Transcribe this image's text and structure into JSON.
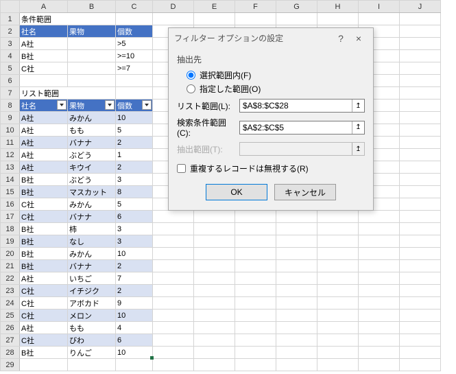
{
  "columns": [
    "A",
    "B",
    "C",
    "D",
    "E",
    "F",
    "G",
    "H",
    "I",
    "J"
  ],
  "section1": {
    "title": "条件範囲",
    "headers": [
      "社名",
      "果物",
      "個数"
    ],
    "rows": [
      {
        "c0": "A社",
        "c1": "",
        "c2": ">5"
      },
      {
        "c0": "B社",
        "c1": "",
        "c2": ">=10"
      },
      {
        "c0": "C社",
        "c1": "",
        "c2": ">=7"
      }
    ]
  },
  "section2": {
    "title": "リスト範囲",
    "headers": [
      "社名",
      "果物",
      "個数"
    ],
    "rows": [
      {
        "c0": "A社",
        "c1": "みかん",
        "c2": "10"
      },
      {
        "c0": "A社",
        "c1": "もも",
        "c2": "5"
      },
      {
        "c0": "A社",
        "c1": "バナナ",
        "c2": "2"
      },
      {
        "c0": "A社",
        "c1": "ぶどう",
        "c2": "1"
      },
      {
        "c0": "A社",
        "c1": "キウイ",
        "c2": "2"
      },
      {
        "c0": "B社",
        "c1": "ぶどう",
        "c2": "3"
      },
      {
        "c0": "B社",
        "c1": "マスカット",
        "c2": "8"
      },
      {
        "c0": "C社",
        "c1": "みかん",
        "c2": "5"
      },
      {
        "c0": "C社",
        "c1": "バナナ",
        "c2": "6"
      },
      {
        "c0": "B社",
        "c1": "柿",
        "c2": "3"
      },
      {
        "c0": "B社",
        "c1": "なし",
        "c2": "3"
      },
      {
        "c0": "B社",
        "c1": "みかん",
        "c2": "10"
      },
      {
        "c0": "B社",
        "c1": "バナナ",
        "c2": "2"
      },
      {
        "c0": "A社",
        "c1": "いちご",
        "c2": "7"
      },
      {
        "c0": "C社",
        "c1": "イチジク",
        "c2": "2"
      },
      {
        "c0": "C社",
        "c1": "アボカド",
        "c2": "9"
      },
      {
        "c0": "C社",
        "c1": "メロン",
        "c2": "10"
      },
      {
        "c0": "A社",
        "c1": "もも",
        "c2": "4"
      },
      {
        "c0": "C社",
        "c1": "びわ",
        "c2": "6"
      },
      {
        "c0": "B社",
        "c1": "りんご",
        "c2": "10"
      }
    ]
  },
  "dialog": {
    "title": "フィルター オプションの設定",
    "help": "?",
    "close": "×",
    "extract_label": "抽出先",
    "radio1": "選択範囲内(F)",
    "radio2": "指定した範囲(O)",
    "field1_label": "リスト範囲(L):",
    "field1_value": "$A$8:$C$28",
    "field2_label": "検索条件範囲(C):",
    "field2_value": "$A$2:$C$5",
    "field3_label": "抽出範囲(T):",
    "field3_value": "",
    "check_label": "重複するレコードは無視する(R)",
    "ok": "OK",
    "cancel": "キャンセル",
    "pick_icon": "↥"
  }
}
